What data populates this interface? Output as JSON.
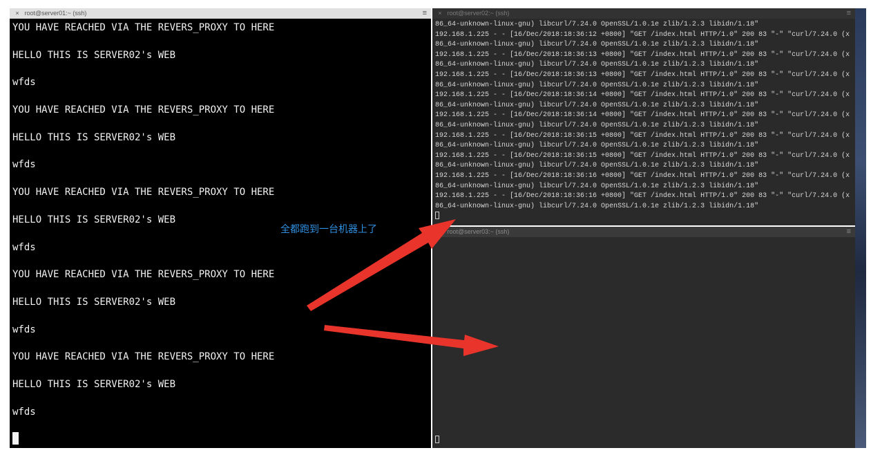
{
  "panes": {
    "server01": {
      "title": "root@server01:~ (ssh)",
      "close_glyph": "×",
      "menu_glyph": "≡",
      "lines": [
        "YOU HAVE REACHED VIA THE REVERS_PROXY TO HERE",
        "HELLO THIS IS SERVER02's WEB",
        "wfds",
        "YOU HAVE REACHED VIA THE REVERS_PROXY TO HERE",
        "HELLO THIS IS SERVER02's WEB",
        "wfds",
        "YOU HAVE REACHED VIA THE REVERS_PROXY TO HERE",
        "HELLO THIS IS SERVER02's WEB",
        "wfds",
        "YOU HAVE REACHED VIA THE REVERS_PROXY TO HERE",
        "HELLO THIS IS SERVER02's WEB",
        "wfds",
        "YOU HAVE REACHED VIA THE REVERS_PROXY TO HERE",
        "HELLO THIS IS SERVER02's WEB",
        "wfds"
      ]
    },
    "server02": {
      "title": "root@server02:~ (ssh)",
      "close_glyph": "×",
      "menu_glyph": "≡",
      "lines": [
        "86_64-unknown-linux-gnu) libcurl/7.24.0 OpenSSL/1.0.1e zlib/1.2.3 libidn/1.18\"",
        "192.168.1.225 - - [16/Dec/2018:18:36:12 +0800] \"GET /index.html HTTP/1.0\" 200 83 \"-\" \"curl/7.24.0 (x",
        "86_64-unknown-linux-gnu) libcurl/7.24.0 OpenSSL/1.0.1e zlib/1.2.3 libidn/1.18\"",
        "192.168.1.225 - - [16/Dec/2018:18:36:13 +0800] \"GET /index.html HTTP/1.0\" 200 83 \"-\" \"curl/7.24.0 (x",
        "86_64-unknown-linux-gnu) libcurl/7.24.0 OpenSSL/1.0.1e zlib/1.2.3 libidn/1.18\"",
        "192.168.1.225 - - [16/Dec/2018:18:36:13 +0800] \"GET /index.html HTTP/1.0\" 200 83 \"-\" \"curl/7.24.0 (x",
        "86_64-unknown-linux-gnu) libcurl/7.24.0 OpenSSL/1.0.1e zlib/1.2.3 libidn/1.18\"",
        "192.168.1.225 - - [16/Dec/2018:18:36:14 +0800] \"GET /index.html HTTP/1.0\" 200 83 \"-\" \"curl/7.24.0 (x",
        "86_64-unknown-linux-gnu) libcurl/7.24.0 OpenSSL/1.0.1e zlib/1.2.3 libidn/1.18\"",
        "192.168.1.225 - - [16/Dec/2018:18:36:14 +0800] \"GET /index.html HTTP/1.0\" 200 83 \"-\" \"curl/7.24.0 (x",
        "86_64-unknown-linux-gnu) libcurl/7.24.0 OpenSSL/1.0.1e zlib/1.2.3 libidn/1.18\"",
        "192.168.1.225 - - [16/Dec/2018:18:36:15 +0800] \"GET /index.html HTTP/1.0\" 200 83 \"-\" \"curl/7.24.0 (x",
        "86_64-unknown-linux-gnu) libcurl/7.24.0 OpenSSL/1.0.1e zlib/1.2.3 libidn/1.18\"",
        "192.168.1.225 - - [16/Dec/2018:18:36:15 +0800] \"GET /index.html HTTP/1.0\" 200 83 \"-\" \"curl/7.24.0 (x",
        "86_64-unknown-linux-gnu) libcurl/7.24.0 OpenSSL/1.0.1e zlib/1.2.3 libidn/1.18\"",
        "192.168.1.225 - - [16/Dec/2018:18:36:16 +0800] \"GET /index.html HTTP/1.0\" 200 83 \"-\" \"curl/7.24.0 (x",
        "86_64-unknown-linux-gnu) libcurl/7.24.0 OpenSSL/1.0.1e zlib/1.2.3 libidn/1.18\"",
        "192.168.1.225 - - [16/Dec/2018:18:36:16 +0800] \"GET /index.html HTTP/1.0\" 200 83 \"-\" \"curl/7.24.0 (x",
        "86_64-unknown-linux-gnu) libcurl/7.24.0 OpenSSL/1.0.1e zlib/1.2.3 libidn/1.18\""
      ]
    },
    "server03": {
      "title": "root@server03:~ (ssh)",
      "close_glyph": "×",
      "menu_glyph": "≡"
    }
  },
  "annotation": {
    "text": "全都跑到一台机器上了",
    "text_color": "#2f8fe0",
    "arrow_color": "#e8342a"
  }
}
